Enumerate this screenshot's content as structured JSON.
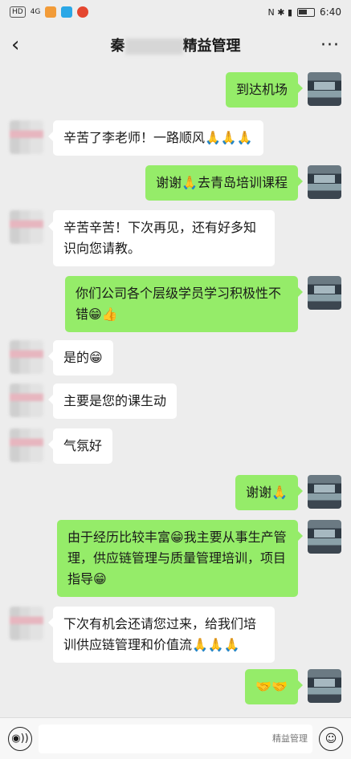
{
  "status_bar": {
    "left_badge": "HD",
    "left_signal": "4G",
    "time": "6:40",
    "right_icons": "N ✱ ▮"
  },
  "header": {
    "back_glyph": "‹",
    "title_prefix": "秦",
    "title_suffix": "精益管理",
    "more_glyph": "···"
  },
  "messages": [
    {
      "side": "right",
      "text": "到达机场"
    },
    {
      "side": "left",
      "text": "辛苦了李老师！一路顺风🙏🙏🙏"
    },
    {
      "side": "right",
      "text": "谢谢🙏去青岛培训课程"
    },
    {
      "side": "left",
      "text": "辛苦辛苦！下次再见，还有好多知识向您请教。"
    },
    {
      "side": "right",
      "text": "你们公司各个层级学员学习积极性不错😁👍"
    },
    {
      "side": "left",
      "text": "是的😁"
    },
    {
      "side": "left",
      "text": "主要是您的课生动"
    },
    {
      "side": "left",
      "text": "气氛好"
    },
    {
      "side": "right",
      "text": "谢谢🙏"
    },
    {
      "side": "right",
      "text": "由于经历比较丰富😁我主要从事生产管理，供应链管理与质量管理培训，项目指导😁"
    },
    {
      "side": "left",
      "text": "下次有机会还请您过来，给我们培训供应链管理和价值流🙏🙏🙏"
    },
    {
      "side": "right",
      "text": "🤝🤝"
    }
  ],
  "input_bar": {
    "voice_glyph": "◉))",
    "emoji_glyph": "☺",
    "watermark": "精益管理"
  },
  "colors": {
    "background": "#ededed",
    "bubble_self": "#95ec69",
    "bubble_other": "#ffffff"
  }
}
